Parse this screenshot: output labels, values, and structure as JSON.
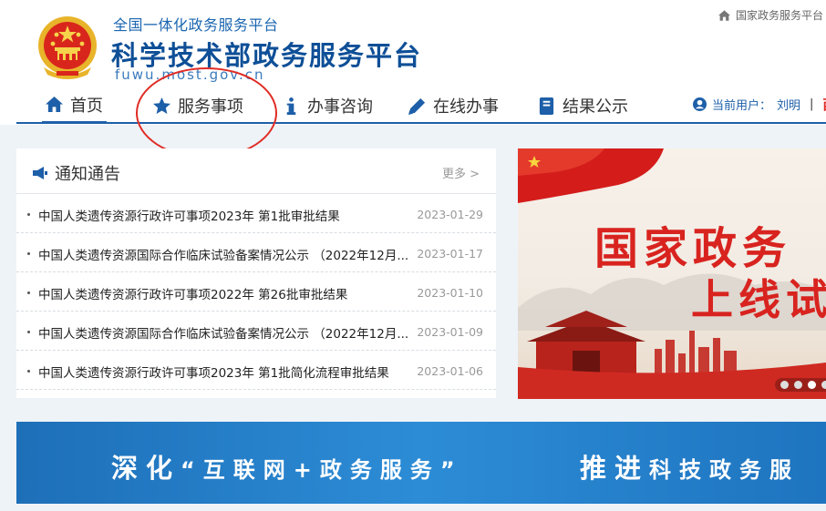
{
  "brand": {
    "subtitle": "全国一体化政务服务平台",
    "title": "科学技术部政务服务平台",
    "domain": "fuwu.most.gov.cn"
  },
  "top_link": {
    "label": "国家政务服务平台",
    "icon": "home-icon"
  },
  "nav": {
    "items": [
      {
        "label": "首页",
        "icon": "home-icon",
        "active": true
      },
      {
        "label": "服务事项",
        "icon": "star-icon",
        "active": false
      },
      {
        "label": "办事咨询",
        "icon": "info-icon",
        "active": false
      },
      {
        "label": "在线办事",
        "icon": "pencil-icon",
        "active": false
      },
      {
        "label": "结果公示",
        "icon": "book-icon",
        "active": false
      }
    ],
    "user_label": "当前用户：",
    "user_name": "刘明",
    "separator": "|",
    "cut_text": "西"
  },
  "notice": {
    "title": "通知通告",
    "more": "更多 >",
    "items": [
      {
        "text": "中国人类遗传资源行政许可事项2023年 第1批审批结果",
        "date": "2023-01-29"
      },
      {
        "text": "中国人类遗传资源国际合作临床试验备案情况公示 （2022年12月...",
        "date": "2023-01-17"
      },
      {
        "text": "中国人类遗传资源行政许可事项2022年 第26批审批结果",
        "date": "2023-01-10"
      },
      {
        "text": "中国人类遗传资源国际合作临床试验备案情况公示 （2022年12月...",
        "date": "2023-01-09"
      },
      {
        "text": "中国人类遗传资源行政许可事项2023年 第1批简化流程审批结果",
        "date": "2023-01-06"
      }
    ]
  },
  "banner": {
    "line1": "国家政务",
    "line2": "上线试",
    "slides": 4,
    "active_slide": 3
  },
  "slogan": {
    "part1": "深化",
    "part2": "“互联网+政务服务”",
    "part3": "推进",
    "part4": "科技政务服"
  },
  "colors": {
    "primary": "#1d5fa8",
    "accent_red": "#d8231f",
    "annotation": "#e02b24"
  }
}
